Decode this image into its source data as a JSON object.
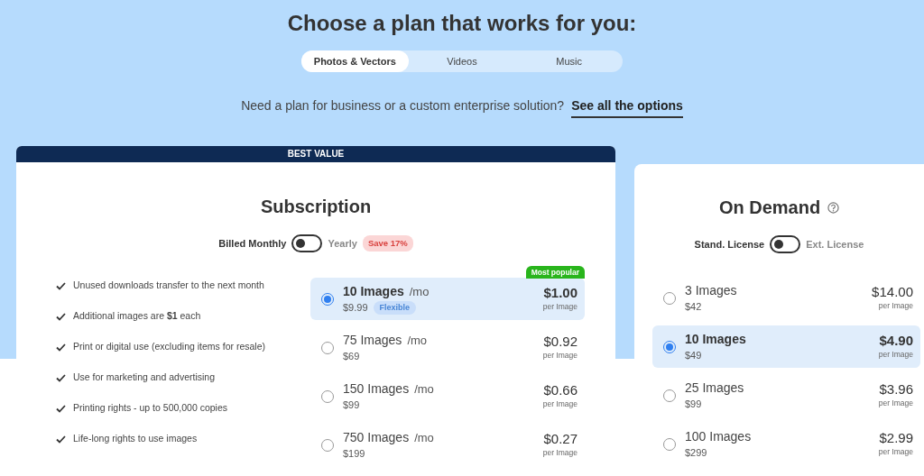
{
  "heading": "Choose a plan that works for you:",
  "tabs": [
    {
      "label": "Photos & Vectors",
      "selected": true
    },
    {
      "label": "Videos",
      "selected": false
    },
    {
      "label": "Music",
      "selected": false
    }
  ],
  "business_prompt": {
    "text": "Need a plan for business or a custom enterprise solution?",
    "link": "See all the options"
  },
  "subscription": {
    "banner": "BEST VALUE",
    "title": "Subscription",
    "toggle": {
      "left_label": "Billed Monthly",
      "right_label": "Yearly",
      "on": false,
      "badge": "Save 17%"
    },
    "features": [
      "Unused downloads transfer to the next month",
      "Additional images are **$1** each",
      "Print or digital use (excluding items for resale)",
      "Use for marketing and advertising",
      "Printing rights - up to 500,000 copies",
      "Life-long rights to use images"
    ],
    "options": [
      {
        "name": "10 Images",
        "period": "/mo",
        "price": "$9.99",
        "tag": "Flexible",
        "ribbon": "Most popular",
        "unit_price": "$1.00",
        "unit_label": "per Image",
        "selected": true
      },
      {
        "name": "75 Images",
        "period": "/mo",
        "price": "$69",
        "unit_price": "$0.92",
        "unit_label": "per Image",
        "selected": false
      },
      {
        "name": "150 Images",
        "period": "/mo",
        "price": "$99",
        "unit_price": "$0.66",
        "unit_label": "per Image",
        "selected": false
      },
      {
        "name": "750 Images",
        "period": "/mo",
        "price": "$199",
        "unit_price": "$0.27",
        "unit_label": "per Image",
        "selected": false
      }
    ]
  },
  "on_demand": {
    "title": "On Demand",
    "toggle": {
      "left_label": "Stand. License",
      "right_label": "Ext. License",
      "on": false
    },
    "options": [
      {
        "name": "3 Images",
        "price": "$42",
        "unit_price": "$14.00",
        "unit_label": "per Image",
        "selected": false
      },
      {
        "name": "10 Images",
        "price": "$49",
        "unit_price": "$4.90",
        "unit_label": "per Image",
        "selected": true
      },
      {
        "name": "25 Images",
        "price": "$99",
        "unit_price": "$3.96",
        "unit_label": "per Image",
        "selected": false
      },
      {
        "name": "100 Images",
        "price": "$299",
        "unit_price": "$2.99",
        "unit_label": "per Image",
        "selected": false
      }
    ]
  }
}
